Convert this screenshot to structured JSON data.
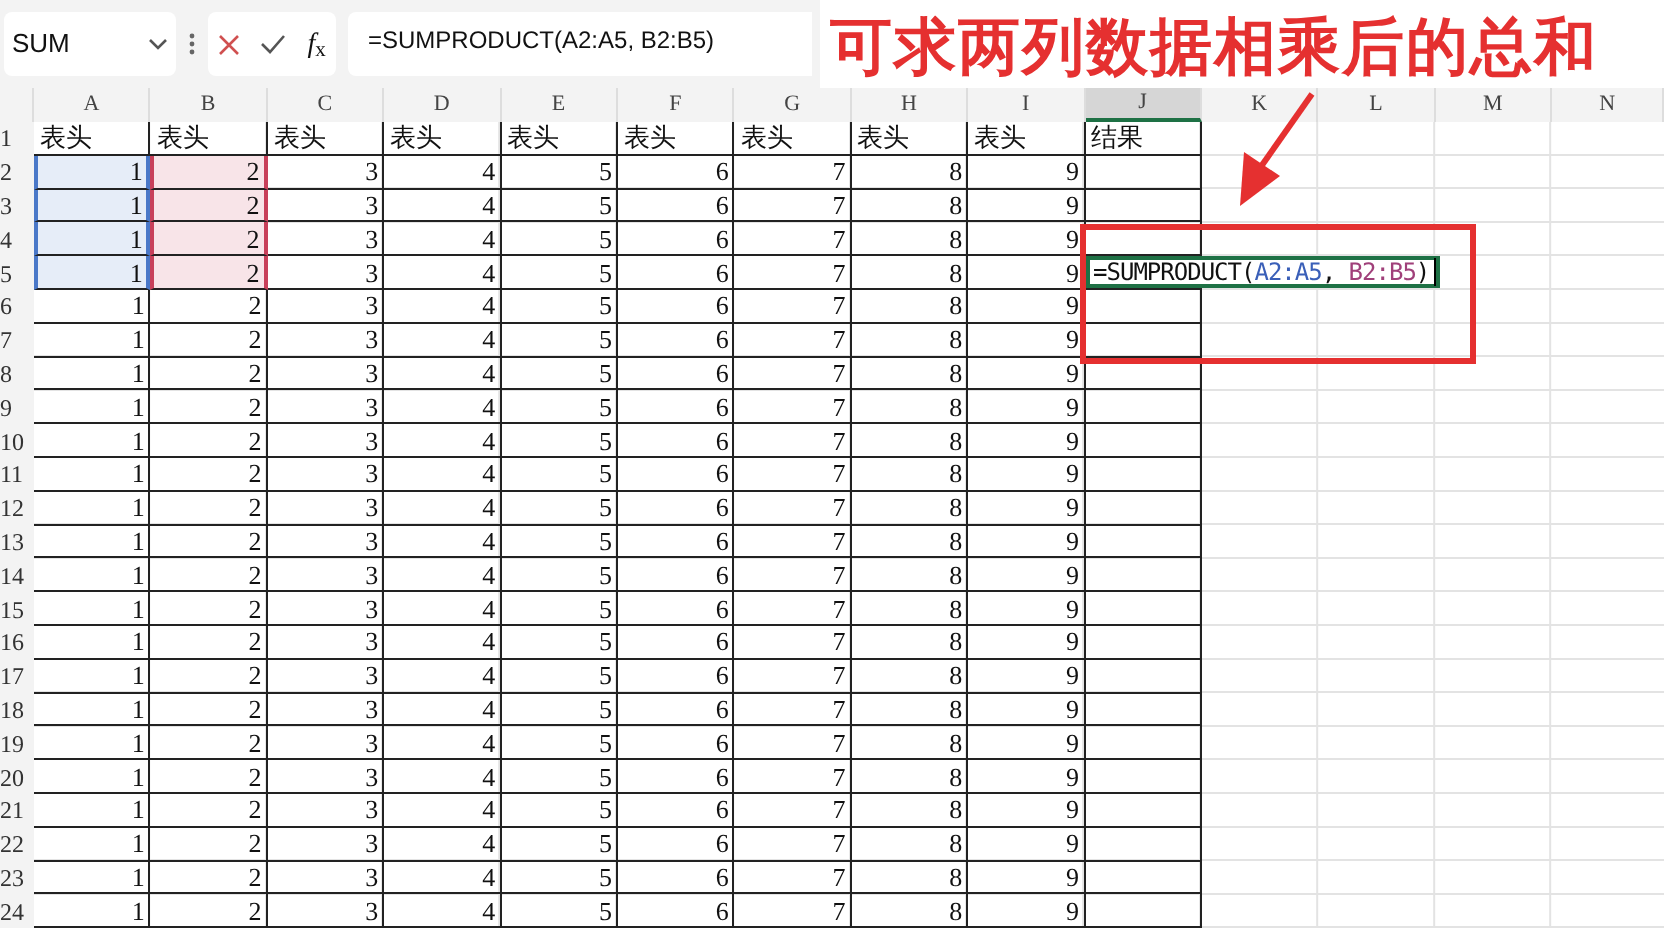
{
  "name_box": {
    "value": "SUM"
  },
  "formula_bar": {
    "fx": "*f*$_{x}$",
    "value": "=SUMPRODUCT(A2:A5, B2:B5)"
  },
  "columns": [
    {
      "label": "A",
      "selected": false
    },
    {
      "label": "B",
      "selected": false
    },
    {
      "label": "C",
      "selected": false
    },
    {
      "label": "D",
      "selected": false
    },
    {
      "label": "E",
      "selected": false
    },
    {
      "label": "F",
      "selected": false
    },
    {
      "label": "G",
      "selected": false
    },
    {
      "label": "H",
      "selected": false
    },
    {
      "label": "I",
      "selected": false
    },
    {
      "label": "J",
      "selected": true
    },
    {
      "label": "K",
      "selected": false
    },
    {
      "label": "L",
      "selected": false
    },
    {
      "label": "M",
      "selected": false
    },
    {
      "label": "N",
      "selected": false
    }
  ],
  "rows": [
    {
      "number": "1",
      "kind": "header",
      "cells": [
        "表头",
        "表头",
        "表头",
        "表头",
        "表头",
        "表头",
        "表头",
        "表头",
        "表头",
        "结果"
      ]
    },
    {
      "number": "2",
      "kind": "data",
      "cells": [
        "1",
        "2",
        "3",
        "4",
        "5",
        "6",
        "7",
        "8",
        "9"
      ],
      "highlights": [
        {
          "color": "#4a78c8"
        },
        {
          "color": "#c8405a"
        }
      ]
    },
    {
      "number": "3",
      "kind": "data",
      "cells": [
        "1",
        "2",
        "3",
        "4",
        "5",
        "6",
        "7",
        "8",
        "9"
      ],
      "highlights": [
        {
          "color": "#4a78c8"
        },
        {
          "color": "#c8405a"
        }
      ]
    },
    {
      "number": "4",
      "kind": "data",
      "cells": [
        "1",
        "2",
        "3",
        "4",
        "5",
        "6",
        "7",
        "8",
        "9"
      ],
      "highlights": [
        {
          "color": "#4a78c8"
        },
        {
          "color": "#c8405a"
        }
      ]
    },
    {
      "number": "5",
      "kind": "data",
      "cells": [
        "1",
        "2",
        "3",
        "4",
        "5",
        "6",
        "7",
        "8",
        "9"
      ],
      "highlights": [
        {
          "color": "#4a78c8"
        },
        {
          "color": "#c8405a"
        }
      ],
      "editing": [
        {
          "text": "=SUMPRODUCT(",
          "color": "#111111"
        },
        {
          "text": "A2:A5",
          "color": "#3a5fb8"
        },
        {
          "text": ", ",
          "color": "#111111"
        },
        {
          "text": "B2:B5",
          "color": "#a0407a"
        },
        {
          "text": ")",
          "color": "#111111"
        }
      ]
    },
    {
      "number": "6",
      "kind": "data",
      "cells": [
        "1",
        "2",
        "3",
        "4",
        "5",
        "6",
        "7",
        "8",
        "9"
      ]
    },
    {
      "number": "7",
      "kind": "data",
      "cells": [
        "1",
        "2",
        "3",
        "4",
        "5",
        "6",
        "7",
        "8",
        "9"
      ]
    },
    {
      "number": "8",
      "kind": "data",
      "cells": [
        "1",
        "2",
        "3",
        "4",
        "5",
        "6",
        "7",
        "8",
        "9"
      ]
    },
    {
      "number": "9",
      "kind": "data",
      "cells": [
        "1",
        "2",
        "3",
        "4",
        "5",
        "6",
        "7",
        "8",
        "9"
      ]
    },
    {
      "number": "10",
      "kind": "data",
      "cells": [
        "1",
        "2",
        "3",
        "4",
        "5",
        "6",
        "7",
        "8",
        "9"
      ]
    },
    {
      "number": "11",
      "kind": "data",
      "cells": [
        "1",
        "2",
        "3",
        "4",
        "5",
        "6",
        "7",
        "8",
        "9"
      ]
    },
    {
      "number": "12",
      "kind": "data",
      "cells": [
        "1",
        "2",
        "3",
        "4",
        "5",
        "6",
        "7",
        "8",
        "9"
      ]
    },
    {
      "number": "13",
      "kind": "data",
      "cells": [
        "1",
        "2",
        "3",
        "4",
        "5",
        "6",
        "7",
        "8",
        "9"
      ]
    },
    {
      "number": "14",
      "kind": "data",
      "cells": [
        "1",
        "2",
        "3",
        "4",
        "5",
        "6",
        "7",
        "8",
        "9"
      ]
    },
    {
      "number": "15",
      "kind": "data",
      "cells": [
        "1",
        "2",
        "3",
        "4",
        "5",
        "6",
        "7",
        "8",
        "9"
      ]
    },
    {
      "number": "16",
      "kind": "data",
      "cells": [
        "1",
        "2",
        "3",
        "4",
        "5",
        "6",
        "7",
        "8",
        "9"
      ]
    },
    {
      "number": "17",
      "kind": "data",
      "cells": [
        "1",
        "2",
        "3",
        "4",
        "5",
        "6",
        "7",
        "8",
        "9"
      ]
    },
    {
      "number": "18",
      "kind": "data",
      "cells": [
        "1",
        "2",
        "3",
        "4",
        "5",
        "6",
        "7",
        "8",
        "9"
      ]
    },
    {
      "number": "19",
      "kind": "data",
      "cells": [
        "1",
        "2",
        "3",
        "4",
        "5",
        "6",
        "7",
        "8",
        "9"
      ]
    },
    {
      "number": "20",
      "kind": "data",
      "cells": [
        "1",
        "2",
        "3",
        "4",
        "5",
        "6",
        "7",
        "8",
        "9"
      ]
    },
    {
      "number": "21",
      "kind": "data",
      "cells": [
        "1",
        "2",
        "3",
        "4",
        "5",
        "6",
        "7",
        "8",
        "9"
      ]
    },
    {
      "number": "22",
      "kind": "data",
      "cells": [
        "1",
        "2",
        "3",
        "4",
        "5",
        "6",
        "7",
        "8",
        "9"
      ]
    },
    {
      "number": "23",
      "kind": "data",
      "cells": [
        "1",
        "2",
        "3",
        "4",
        "5",
        "6",
        "7",
        "8",
        "9"
      ]
    },
    {
      "number": "24",
      "kind": "data",
      "cells": [
        "1",
        "2",
        "3",
        "4",
        "5",
        "6",
        "7",
        "8",
        "9"
      ]
    }
  ],
  "annotation": {
    "text": "可求两列数据相乘后的总和"
  }
}
